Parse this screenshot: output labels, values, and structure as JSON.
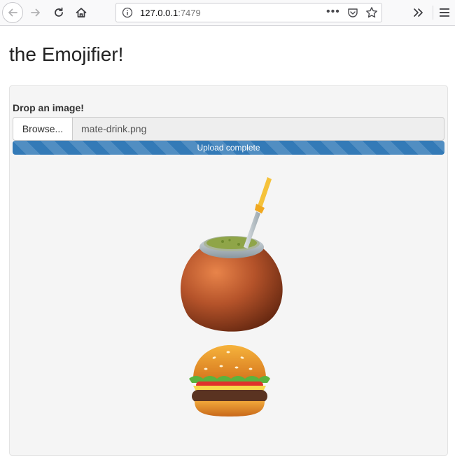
{
  "browser": {
    "url_host": "127.0.0.1",
    "url_port": ":7479",
    "icons": [
      "back-arrow-icon",
      "forward-arrow-icon",
      "reload-icon",
      "home-icon",
      "info-icon",
      "more-dots-icon",
      "pocket-icon",
      "bookmark-star-icon",
      "overflow-chevrons-icon",
      "hamburger-menu-icon"
    ]
  },
  "page": {
    "title": "the Emojifier!"
  },
  "upload": {
    "label": "Drop an image!",
    "browse_label": "Browse...",
    "file_name": "mate-drink.png",
    "progress_text": "Upload complete",
    "progress_percent": 100
  },
  "result": {
    "images": [
      "mate-drink-emoji",
      "hamburger-emoji"
    ]
  },
  "colors": {
    "progress": "#337ab7",
    "well_bg": "#f5f5f5"
  }
}
